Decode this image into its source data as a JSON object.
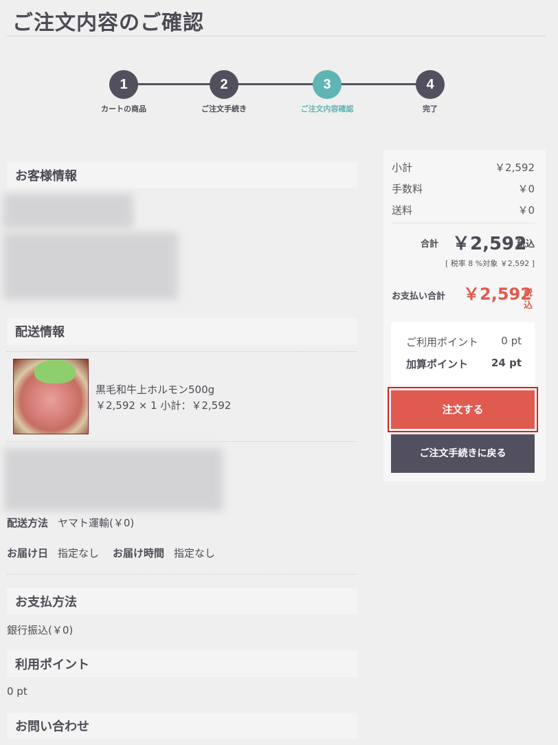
{
  "page_title": "ご注文内容のご確認",
  "steps": [
    {
      "num": "1",
      "label": "カートの商品"
    },
    {
      "num": "2",
      "label": "ご注文手続き"
    },
    {
      "num": "3",
      "label": "ご注文内容確認"
    },
    {
      "num": "4",
      "label": "完了"
    }
  ],
  "active_step": 3,
  "sections": {
    "customer": "お客様情報",
    "shipping": "配送情報",
    "payment": "お支払方法",
    "points": "利用ポイント",
    "inquiry": "お問い合わせ"
  },
  "product": {
    "name": "黒毛和牛上ホルモン500g",
    "price_line": "￥2,592 × 1  小計：￥2,592"
  },
  "shipping_info": {
    "method_label": "配送方法",
    "method_value": "ヤマト運輸(￥0)",
    "date_label": "お届け日",
    "date_value": "指定なし",
    "time_label": "お届け時間",
    "time_value": "指定なし"
  },
  "payment_value": "銀行振込(￥0)",
  "points_value": "0 pt",
  "summary": {
    "subtotal_label": "小計",
    "subtotal_value": "￥2,592",
    "fee_label": "手数料",
    "fee_value": "￥0",
    "shipping_label": "送料",
    "shipping_value": "￥0",
    "total_label": "合計",
    "total_value": "￥2,592",
    "total_tax": "税込",
    "tax_note": "[ 税率 8 %対象  ￥2,592 ]",
    "pay_total_label": "お支払い合計",
    "pay_total_value": "￥2,592",
    "pay_total_tax": "税込",
    "used_points_label": "ご利用ポイント",
    "used_points_value": "0 pt",
    "added_points_label": "加算ポイント",
    "added_points_value": "24 pt"
  },
  "buttons": {
    "order": "注文する",
    "back": "ご注文手続きに戻る"
  },
  "colors": {
    "accent_teal": "#5fb4b4",
    "order_red": "#df5a4f",
    "dark": "#52505e"
  }
}
